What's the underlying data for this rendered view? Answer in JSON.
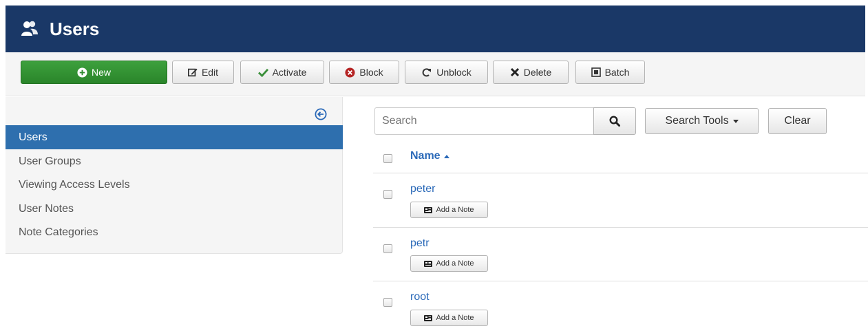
{
  "header": {
    "title": "Users",
    "icon": "users-icon",
    "background": "#1a3867"
  },
  "toolbar": {
    "new_label": "New",
    "edit_label": "Edit",
    "activate_label": "Activate",
    "block_label": "Block",
    "unblock_label": "Unblock",
    "delete_label": "Delete",
    "batch_label": "Batch",
    "new_color": "#2f8f2f"
  },
  "sidebar": {
    "collapse_icon": "collapse-left-icon",
    "items": [
      {
        "label": "Users",
        "active": true
      },
      {
        "label": "User Groups",
        "active": false
      },
      {
        "label": "Viewing Access Levels",
        "active": false
      },
      {
        "label": "User Notes",
        "active": false
      },
      {
        "label": "Note Categories",
        "active": false
      }
    ],
    "active_color": "#2e6fae"
  },
  "search": {
    "placeholder": "Search",
    "value": "",
    "search_tools_label": "Search Tools",
    "clear_label": "Clear"
  },
  "table": {
    "column_name": "Name",
    "sort": "ascending",
    "note_button_label": "Add a Note",
    "rows": [
      {
        "name": "peter"
      },
      {
        "name": "petr"
      },
      {
        "name": "root"
      }
    ]
  },
  "link_color": "#2a69b8"
}
